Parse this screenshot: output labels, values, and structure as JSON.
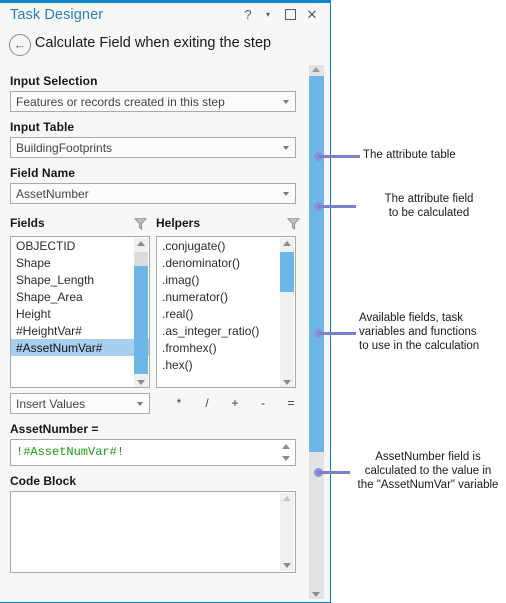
{
  "window": {
    "title": "Task Designer",
    "buttons": {
      "help": "?",
      "menu": "▾",
      "maximize": "maximize-box",
      "close": "✕"
    }
  },
  "header": {
    "back_icon": "←",
    "step_title": "Calculate Field when exiting the step"
  },
  "form": {
    "input_selection": {
      "label": "Input Selection",
      "value": "Features or records created in this step"
    },
    "input_table": {
      "label": "Input Table",
      "value": "BuildingFootprints"
    },
    "field_name": {
      "label": "Field Name",
      "value": "AssetNumber"
    },
    "insert_values": {
      "value": "Insert Values"
    },
    "operators": [
      "*",
      "/",
      "+",
      "-",
      "="
    ],
    "expression": {
      "label": "AssetNumber =",
      "value": "!#AssetNumVar#!"
    },
    "code_block": {
      "label": "Code Block",
      "value": ""
    }
  },
  "lists": {
    "fields": {
      "header": "Fields",
      "filter_icon": "funnel-icon",
      "items": [
        {
          "label": "OBJECTID",
          "selected": false
        },
        {
          "label": "Shape",
          "selected": false
        },
        {
          "label": "Shape_Length",
          "selected": false
        },
        {
          "label": "Shape_Area",
          "selected": false
        },
        {
          "label": "Height",
          "selected": false
        },
        {
          "label": "#HeightVar#",
          "selected": false
        },
        {
          "label": "#AssetNumVar#",
          "selected": true
        }
      ]
    },
    "helpers": {
      "header": "Helpers",
      "filter_icon": "funnel-icon",
      "items": [
        {
          "label": ".conjugate()",
          "selected": false
        },
        {
          "label": ".denominator()",
          "selected": false
        },
        {
          "label": ".imag()",
          "selected": false
        },
        {
          "label": ".numerator()",
          "selected": false
        },
        {
          "label": ".real()",
          "selected": false
        },
        {
          "label": ".as_integer_ratio()",
          "selected": false
        },
        {
          "label": ".fromhex()",
          "selected": false
        },
        {
          "label": ".hex()",
          "selected": false
        }
      ]
    }
  },
  "annotations": [
    {
      "text": "The attribute table"
    },
    {
      "text": "The attribute field\nto be calculated"
    },
    {
      "text": "Available fields, task\nvariables and functions\nto use in the calculation"
    },
    {
      "text": "AssetNumber field is\ncalculated to the value in\nthe \"AssetNumVar\" variable"
    }
  ],
  "colors": {
    "title_blue": "#2a7ec0",
    "panel_border": "#0b7ec4",
    "scroll_thumb": "#6cb6e8",
    "selection": "#a8cfee",
    "expression_text": "#15a015",
    "callout_line": "#7b7fd0"
  }
}
